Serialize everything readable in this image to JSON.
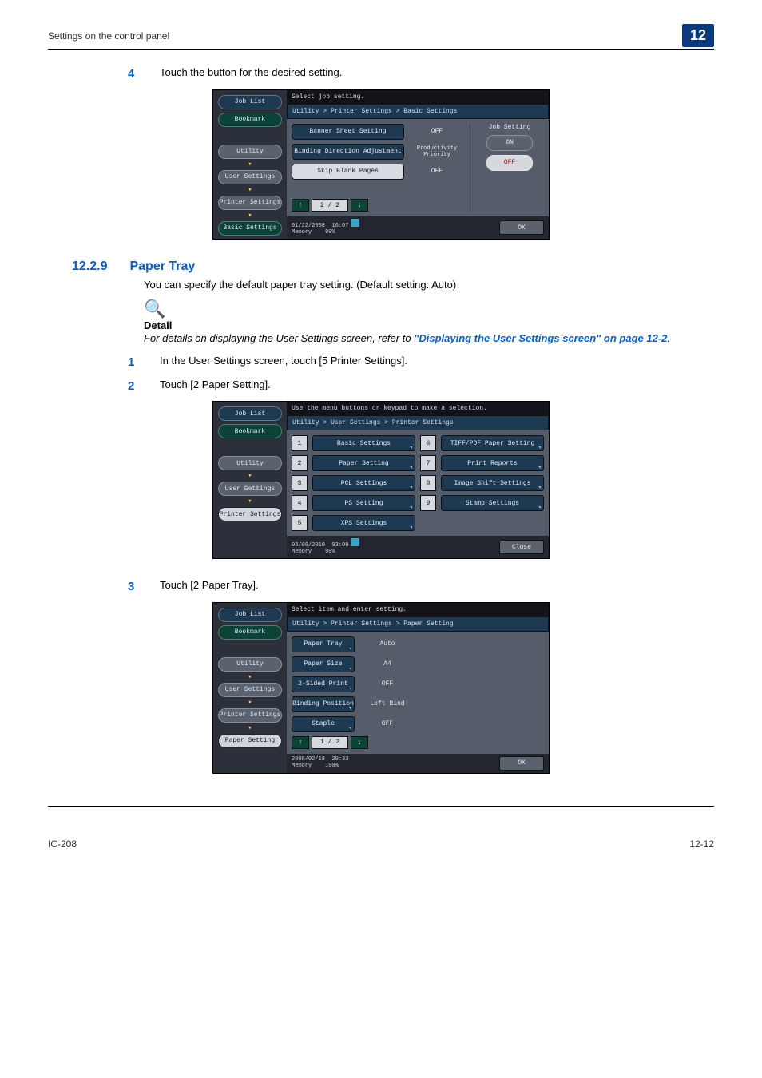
{
  "header": {
    "left": "Settings on the control panel",
    "badge": "12"
  },
  "footer": {
    "left": "IC-208",
    "right": "12-12"
  },
  "step4": {
    "num": "4",
    "text": "Touch the button for the desired setting."
  },
  "section": {
    "num": "12.2.9",
    "title": "Paper Tray"
  },
  "section_desc": "You can specify the default paper tray setting. (Default setting: Auto)",
  "detail": {
    "label": "Detail",
    "text_a": "For details on displaying the User Settings screen, refer to ",
    "link": "\"Displaying the User Settings screen\" on page 12-2",
    "text_b": "."
  },
  "step1": {
    "num": "1",
    "text": "In the User Settings screen, touch [5 Printer Settings]."
  },
  "step2": {
    "num": "2",
    "text": "Touch [2 Paper Setting]."
  },
  "step3": {
    "num": "3",
    "text": "Touch [2 Paper Tray]."
  },
  "panel_a": {
    "left": {
      "job": "Job List",
      "bm": "Bookmark",
      "u": "Utility",
      "us": "User Settings",
      "ps": "Printer Settings",
      "bs": "Basic Settings"
    },
    "top": "Select job setting.",
    "bc": "Utility > Printer Settings > Basic Settings",
    "rows": [
      {
        "label": "Banner Sheet Setting",
        "val": "OFF"
      },
      {
        "label": "Binding Direction Adjustment",
        "val": "Productivity Priority"
      },
      {
        "label": "Skip Blank Pages",
        "val": "OFF"
      }
    ],
    "side": {
      "title": "Job Setting",
      "on": "ON",
      "off": "OFF"
    },
    "pager": "2 / 2",
    "status": {
      "date": "01/22/2008",
      "time": "16:07",
      "mem": "Memory",
      "memv": "90%",
      "ok": "OK"
    }
  },
  "panel_b": {
    "left": {
      "job": "Job List",
      "bm": "Bookmark",
      "u": "Utility",
      "us": "User Settings",
      "ps": "Printer Settings"
    },
    "top": "Use the menu buttons or keypad to make a selection.",
    "bc": "Utility > User Settings > Printer Settings",
    "menu_left": [
      {
        "n": "1",
        "l": "Basic Settings"
      },
      {
        "n": "2",
        "l": "Paper Setting"
      },
      {
        "n": "3",
        "l": "PCL Settings"
      },
      {
        "n": "4",
        "l": "PS Setting"
      },
      {
        "n": "5",
        "l": "XPS Settings"
      }
    ],
    "menu_right": [
      {
        "n": "6",
        "l": "TIFF/PDF Paper Setting"
      },
      {
        "n": "7",
        "l": "Print Reports"
      },
      {
        "n": "8",
        "l": "Image Shift Settings"
      },
      {
        "n": "9",
        "l": "Stamp Settings"
      }
    ],
    "status": {
      "date": "03/09/2010",
      "time": "03:09",
      "mem": "Memory",
      "memv": "90%",
      "close": "Close"
    }
  },
  "panel_c": {
    "left": {
      "job": "Job List",
      "bm": "Bookmark",
      "u": "Utility",
      "us": "User Settings",
      "ps": "Printer Settings",
      "pp": "Paper Setting"
    },
    "top": "Select item and enter setting.",
    "bc": "Utility > Printer Settings > Paper Setting",
    "rows": [
      {
        "label": "Paper Tray",
        "val": "Auto"
      },
      {
        "label": "Paper Size",
        "val": "A4"
      },
      {
        "label": "2-Sided Print",
        "val": "OFF"
      },
      {
        "label": "Binding Position",
        "val": "Left Bind"
      },
      {
        "label": "Staple",
        "val": "OFF"
      }
    ],
    "pager": "1 / 2",
    "status": {
      "date": "2008/02/18",
      "time": "20:33",
      "mem": "Memory",
      "memv": "100%",
      "ok": "OK"
    }
  }
}
